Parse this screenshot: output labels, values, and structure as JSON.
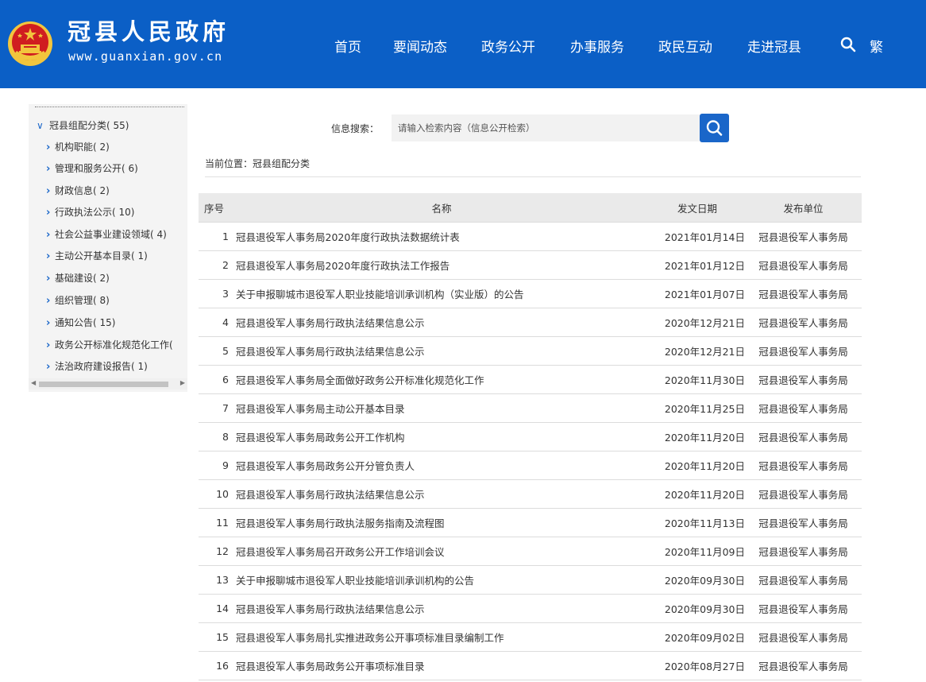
{
  "header": {
    "site_name": "冠县人民政府",
    "site_url": "www.guanxian.gov.cn",
    "nav": [
      "首页",
      "要闻动态",
      "政务公开",
      "办事服务",
      "政民互动",
      "走进冠县"
    ],
    "lang_toggle": "繁",
    "icons": {
      "emblem": "national-emblem-icon",
      "search": "search-icon"
    },
    "colors": {
      "brand_blue": "#0b5fc6",
      "emblem_red": "#d01d20",
      "emblem_gold": "#f2c53d"
    }
  },
  "sidebar": {
    "root": {
      "label": "冠县组配分类",
      "count": "( 55)"
    },
    "items": [
      {
        "label": "机构职能",
        "count": "( 2)"
      },
      {
        "label": "管理和服务公开",
        "count": "( 6)"
      },
      {
        "label": "财政信息",
        "count": "( 2)"
      },
      {
        "label": "行政执法公示",
        "count": "( 10)"
      },
      {
        "label": "社会公益事业建设领域",
        "count": "( 4)"
      },
      {
        "label": "主动公开基本目录",
        "count": "( 1)"
      },
      {
        "label": "基础建设",
        "count": "( 2)"
      },
      {
        "label": "组织管理",
        "count": "( 8)"
      },
      {
        "label": "通知公告",
        "count": "( 15)"
      },
      {
        "label": "政务公开标准化规范化工作",
        "count": "("
      },
      {
        "label": "法治政府建设报告",
        "count": "( 1)"
      }
    ]
  },
  "search": {
    "label": "信息搜索：",
    "placeholder": "请输入检索内容（信息公开检索）"
  },
  "breadcrumb": "当前位置：冠县组配分类",
  "table": {
    "headers": {
      "no": "序号",
      "title": "名称",
      "date": "发文日期",
      "unit": "发布单位"
    },
    "rows": [
      {
        "no": "1",
        "title": "冠县退役军人事务局2020年度行政执法数据统计表",
        "date": "2021年01月14日",
        "unit": "冠县退役军人事务局"
      },
      {
        "no": "2",
        "title": "冠县退役军人事务局2020年度行政执法工作报告",
        "date": "2021年01月12日",
        "unit": "冠县退役军人事务局"
      },
      {
        "no": "3",
        "title": "关于申报聊城市退役军人职业技能培训承训机构（实业版）的公告",
        "date": "2021年01月07日",
        "unit": "冠县退役军人事务局"
      },
      {
        "no": "4",
        "title": "冠县退役军人事务局行政执法结果信息公示",
        "date": "2020年12月21日",
        "unit": "冠县退役军人事务局"
      },
      {
        "no": "5",
        "title": "冠县退役军人事务局行政执法结果信息公示",
        "date": "2020年12月21日",
        "unit": "冠县退役军人事务局"
      },
      {
        "no": "6",
        "title": "冠县退役军人事务局全面做好政务公开标准化规范化工作",
        "date": "2020年11月30日",
        "unit": "冠县退役军人事务局"
      },
      {
        "no": "7",
        "title": "冠县退役军人事务局主动公开基本目录",
        "date": "2020年11月25日",
        "unit": "冠县退役军人事务局"
      },
      {
        "no": "8",
        "title": "冠县退役军人事务局政务公开工作机构",
        "date": "2020年11月20日",
        "unit": "冠县退役军人事务局"
      },
      {
        "no": "9",
        "title": "冠县退役军人事务局政务公开分管负责人",
        "date": "2020年11月20日",
        "unit": "冠县退役军人事务局"
      },
      {
        "no": "10",
        "title": "冠县退役军人事务局行政执法结果信息公示",
        "date": "2020年11月20日",
        "unit": "冠县退役军人事务局"
      },
      {
        "no": "11",
        "title": "冠县退役军人事务局行政执法服务指南及流程图",
        "date": "2020年11月13日",
        "unit": "冠县退役军人事务局"
      },
      {
        "no": "12",
        "title": "冠县退役军人事务局召开政务公开工作培训会议",
        "date": "2020年11月09日",
        "unit": "冠县退役军人事务局"
      },
      {
        "no": "13",
        "title": "关于申报聊城市退役军人职业技能培训承训机构的公告",
        "date": "2020年09月30日",
        "unit": "冠县退役军人事务局"
      },
      {
        "no": "14",
        "title": "冠县退役军人事务局行政执法结果信息公示",
        "date": "2020年09月30日",
        "unit": "冠县退役军人事务局"
      },
      {
        "no": "15",
        "title": "冠县退役军人事务局扎实推进政务公开事项标准目录编制工作",
        "date": "2020年09月02日",
        "unit": "冠县退役军人事务局"
      },
      {
        "no": "16",
        "title": "冠县退役军人事务局政务公开事项标准目录",
        "date": "2020年08月27日",
        "unit": "冠县退役军人事务局"
      }
    ]
  }
}
